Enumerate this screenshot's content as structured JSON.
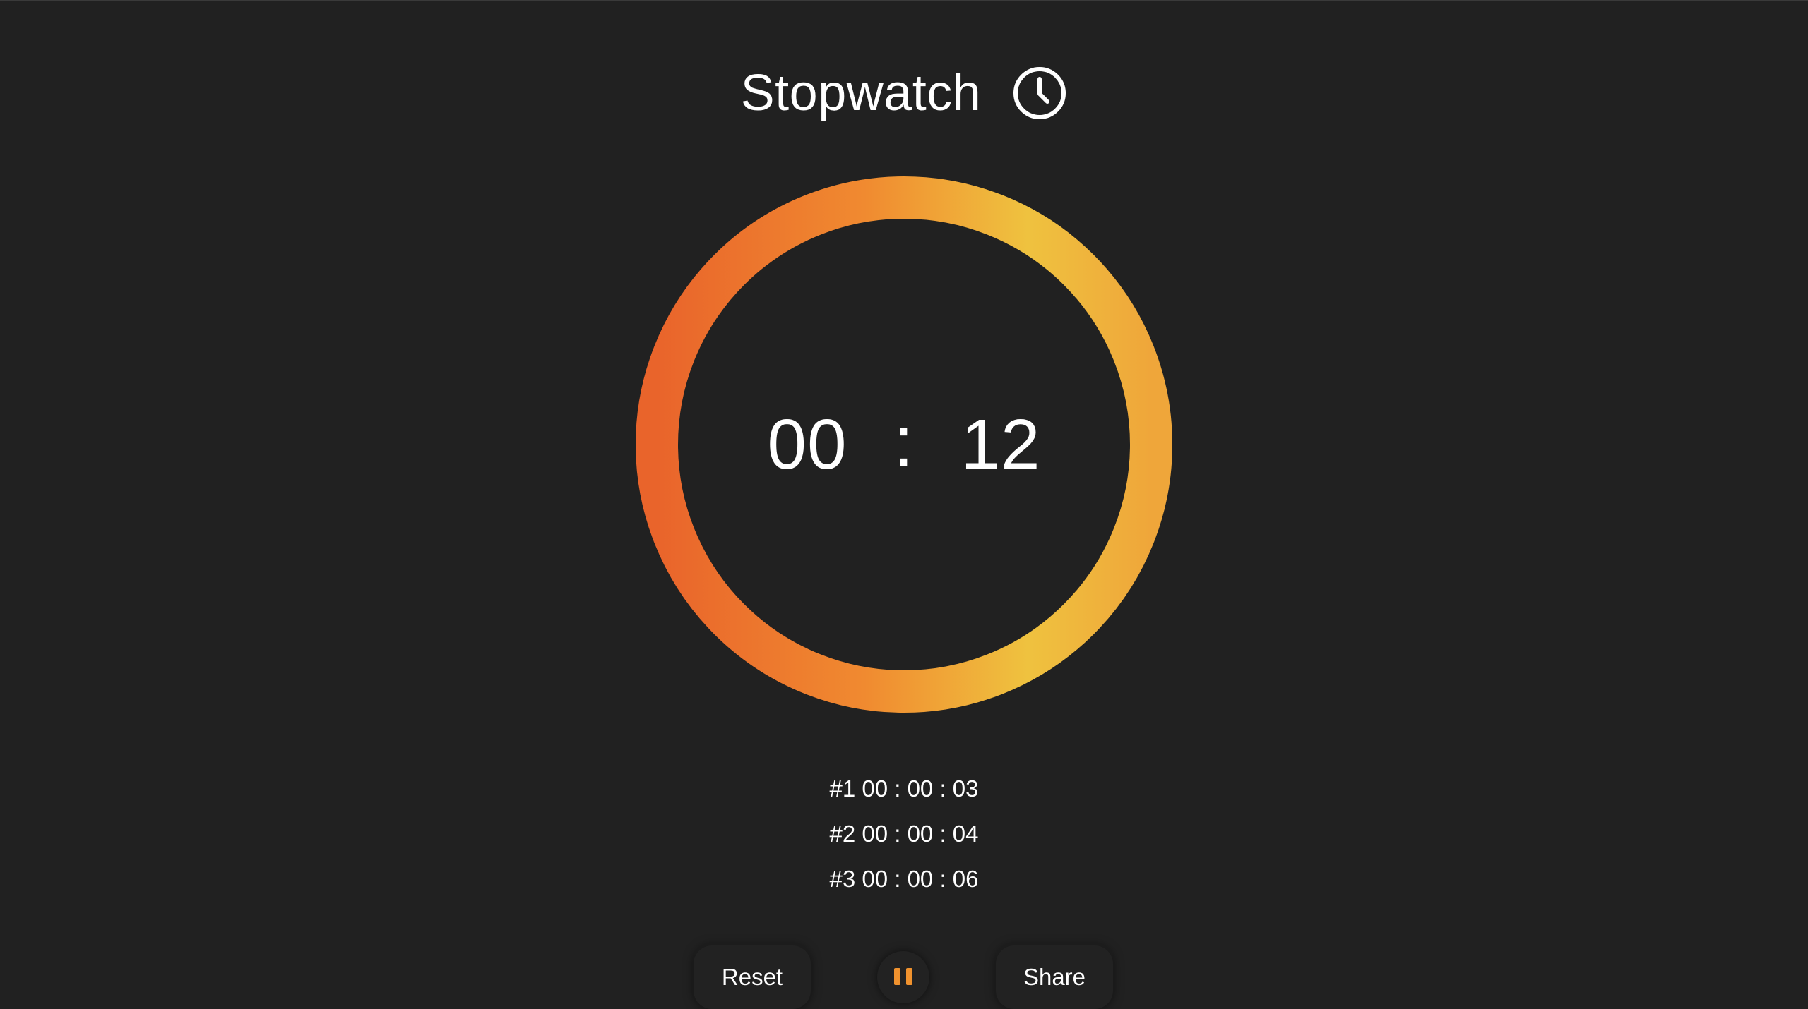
{
  "app": {
    "title": "Stopwatch",
    "title_icon": "clock-icon"
  },
  "timer": {
    "left": "00",
    "separator": ":",
    "right": "12"
  },
  "laps": [
    {
      "label": "#1 00 : 00 : 03"
    },
    {
      "label": "#2 00 : 00 : 04"
    },
    {
      "label": "#3 00 : 00 : 06"
    }
  ],
  "controls": {
    "reset_label": "Reset",
    "pause_icon": "pause-icon",
    "share_label": "Share"
  },
  "colors": {
    "background": "#212121",
    "ring_start": "#E9642B",
    "ring_mid": "#F08A30",
    "ring_end": "#EFC23F",
    "pause_icon": "#F0922E",
    "text": "#FFFFFF"
  }
}
